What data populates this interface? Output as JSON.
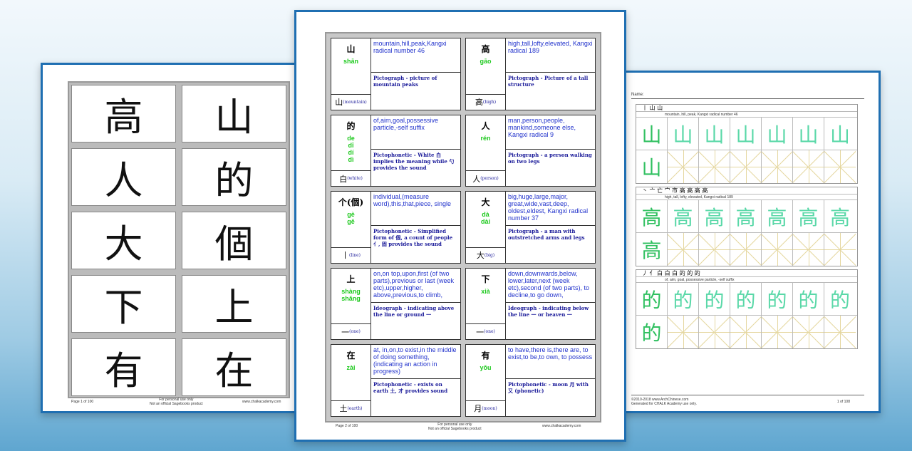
{
  "left": {
    "cards": [
      "高",
      "山",
      "人",
      "的",
      "大",
      "個",
      "下",
      "上",
      "有",
      "在"
    ],
    "footer_left": "Page 1 of 100",
    "footer_center": "For personal use only\nNot an official Sagebooks product",
    "footer_right": "www.chalkacademy.com"
  },
  "middle": {
    "cards": [
      {
        "char": "山",
        "pinyin": "shān",
        "meaning": "mountain,hill,peak,Kangxi radical number 46",
        "note": "Pictograph - picture of mountain peaks",
        "radical": "山",
        "radical_label": "(mountain)"
      },
      {
        "char": "高",
        "pinyin": "gāo",
        "meaning": "high,tall,lofty,elevated, Kangxi radical 189",
        "note": "Pictograph - Picture of a tall structure",
        "radical": "高",
        "radical_label": "(high)"
      },
      {
        "char": "的",
        "pinyin": "de\ndī\ndí\ndì",
        "meaning": "of,aim,goal,possessive particle,-self suffix",
        "note": "Pictophonetic - White 白 implies the meaning while 勺 provides the sound",
        "radical": "白",
        "radical_label": "(white)"
      },
      {
        "char": "人",
        "pinyin": "rén",
        "meaning": "man,person,people, mankind,someone else, Kangxi radical 9",
        "note": "Pictograph - a person walking on two legs",
        "radical": "人",
        "radical_label": "(person)"
      },
      {
        "char": "个(個)",
        "pinyin": "gè\ngě",
        "meaning": "individual,(measure word),this,that,piece, single",
        "note": "Pictophonetic - Simplified form of 個, a count of people 亻, 固 provides the sound",
        "radical": "丨",
        "radical_label": "(line)"
      },
      {
        "char": "大",
        "pinyin": "dà\ndài",
        "meaning": "big,huge,large,major, great,wide,vast,deep, oldest,eldest, Kangxi radical number 37",
        "note": "Pictograph - a man with outstretched arms and legs",
        "radical": "大",
        "radical_label": "(big)"
      },
      {
        "char": "上",
        "pinyin": "shàng\nshǎng",
        "meaning": "on,on top,upon,first (of two parts),previous or last (week etc),upper,higher, above,previous,to climb,",
        "note": "Ideograph - indicating above the line or ground 一",
        "radical": "一",
        "radical_label": "(one)"
      },
      {
        "char": "下",
        "pinyin": "xià",
        "meaning": "down,downwards,below, lower,later,next (week etc),second (of two parts), to decline,to go down,",
        "note": "Ideograph - indicating below the line 一 or heaven 一",
        "radical": "一",
        "radical_label": "(one)"
      },
      {
        "char": "在",
        "pinyin": "zài",
        "meaning": "at, in,on,to exist,in the middle of doing something,(indicating an action in progress)",
        "note": "Pictophonetic - exists on earth 土, 才 provides sound",
        "radical": "土",
        "radical_label": "(earth)"
      },
      {
        "char": "有",
        "pinyin": "yǒu",
        "meaning": "to have,there is,there are, to exist,to be,to own, to possess",
        "note": "Pictophonetic - moon 月 with 又 (phonetic)",
        "radical": "月",
        "radical_label": "(moon)"
      }
    ],
    "footer_left": "Page 2 of 100",
    "footer_center": "For personal use only\nNot an official Sagebooks product",
    "footer_right": "www.chalkacademy.com"
  },
  "right": {
    "name_label": "Name:",
    "blocks": [
      {
        "strokes": "丨 山 山",
        "meaning": "mountain, hill, peak, Kangxi radical number 46",
        "char": "山"
      },
      {
        "strokes": "丶 亠 亡 宀 市 高 高 高 高",
        "meaning": "high, tall, lofty, elevated, Kangxi radical 189",
        "char": "高"
      },
      {
        "strokes": "丿 亻 白 白 白 的 的 的",
        "meaning": "of, aim, goal, possessive particle, -self suffix",
        "char": "的"
      }
    ],
    "footer": "©2010-2018 www.ArchChinese.com\nGenerated for CHALK Academy use only.",
    "footer_page": "1 of 108"
  }
}
